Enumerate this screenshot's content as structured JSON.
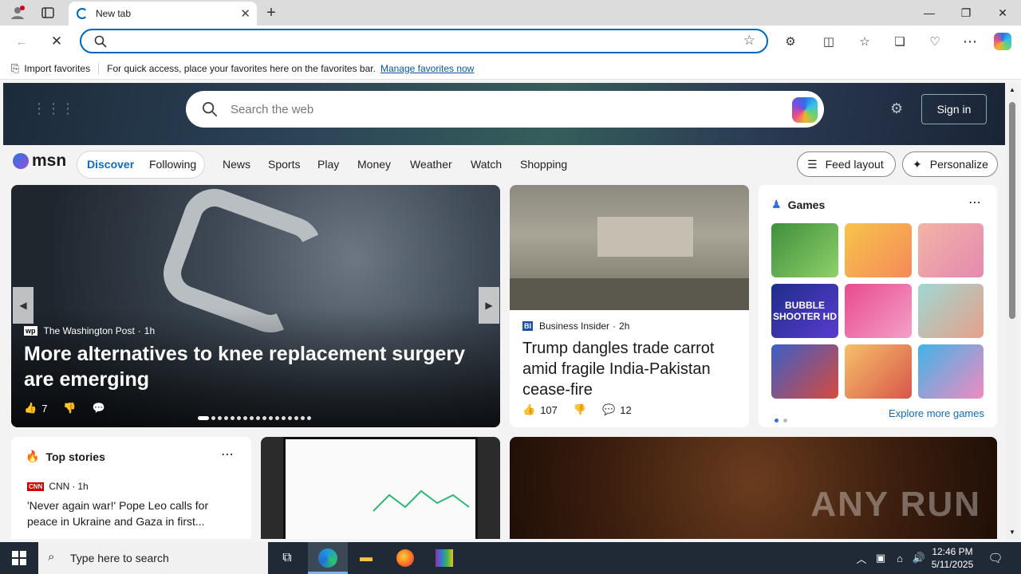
{
  "browser": {
    "tab_title": "New tab",
    "address_value": "",
    "fav_import": "Import favorites",
    "fav_hint": "For quick access, place your favorites here on the favorites bar.",
    "fav_manage": "Manage favorites now"
  },
  "msn": {
    "search_placeholder": "Search the web",
    "signin": "Sign in",
    "logo": "msn",
    "tab_discover": "Discover",
    "tab_following": "Following",
    "nav": [
      "News",
      "Sports",
      "Play",
      "Money",
      "Weather",
      "Watch",
      "Shopping"
    ],
    "feed_layout": "Feed layout",
    "personalize": "Personalize"
  },
  "hero_story": {
    "source": "The Washington Post",
    "time": "1h",
    "headline": "More alternatives to knee replacement surgery are emerging",
    "likes": "7"
  },
  "side_story": {
    "source": "Business Insider",
    "time": "2h",
    "headline": "Trump dangles trade carrot amid fragile India-Pakistan cease-fire",
    "likes": "107",
    "comments": "12"
  },
  "games": {
    "title": "Games",
    "explore": "Explore more games",
    "bubble_label": "BUBBLE SHOOTER HD"
  },
  "top_stories": {
    "title": "Top stories",
    "source": "CNN",
    "time": "1h",
    "headline": "'Never again war!' Pope Leo calls for peace in Ukraine and Gaza in first..."
  },
  "taskbar": {
    "search_placeholder": "Type here to search",
    "time": "12:46 PM",
    "date": "5/11/2025"
  },
  "watermark": "ANY RUN"
}
